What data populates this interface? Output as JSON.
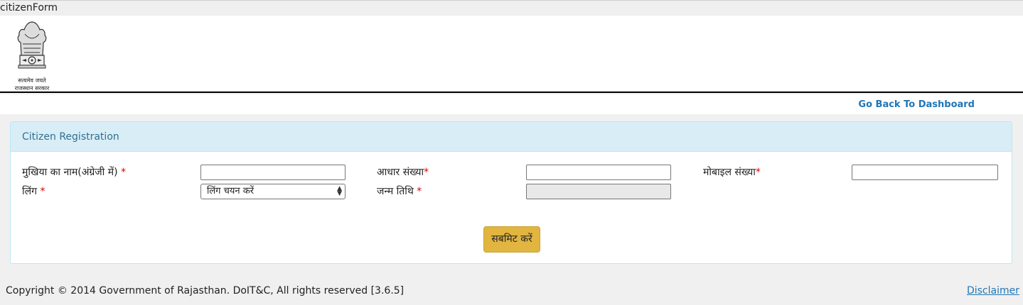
{
  "tab": {
    "title": "citizenForm"
  },
  "emblem": {
    "motto": "सत्यमेव जयते",
    "govt": "राजस्थान सरकार"
  },
  "nav": {
    "back_link": "Go Back To Dashboard"
  },
  "panel": {
    "title": "Citizen Registration"
  },
  "form": {
    "head_name_label": "मुखिया का नाम(अंग्रेजी में)",
    "aadhaar_label": "आधार संख्या",
    "mobile_label": "मोबाइल संख्या",
    "gender_label": "लिंग",
    "gender_selected": "लिंग चयन करें",
    "dob_label": "जन्म तिथि",
    "required_mark": "*",
    "submit_label": "सबमिट करें"
  },
  "footer": {
    "copyright": "Copyright © 2014 Government of Rajasthan. DoIT&C, All rights reserved [3.6.5]",
    "disclaimer": "Disclaimer"
  },
  "colors": {
    "link": "#2176b5",
    "panel_head": "#d9edf7",
    "submit": "#e1b540",
    "required": "#dd0000"
  }
}
